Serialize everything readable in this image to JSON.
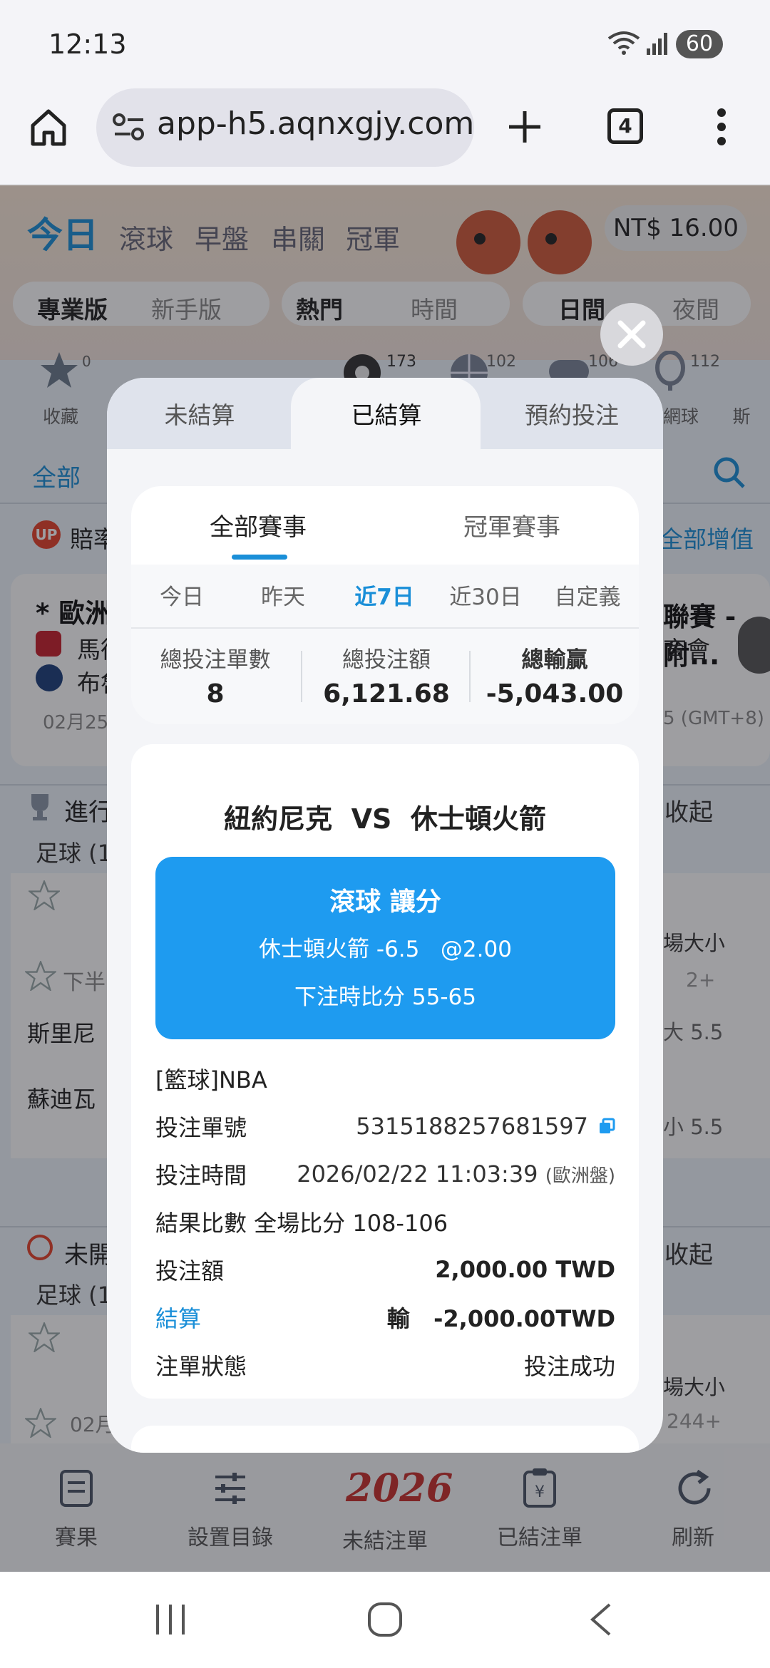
{
  "status": {
    "time": "12:13",
    "battery": "60"
  },
  "browser": {
    "url": "app-h5.aqnxgjy.com",
    "tabs_count": "4"
  },
  "background": {
    "tabs": [
      "今日",
      "滾球",
      "早盤",
      "串關",
      "冠軍"
    ],
    "balance": "NT$ 16.00",
    "modes": [
      "專業版",
      "新手版",
      "熱門",
      "時間",
      "日間",
      "夜間"
    ],
    "categories": [
      {
        "label": "收藏",
        "count": "0"
      },
      {
        "label": "",
        "count": ""
      },
      {
        "label": "",
        "count": ""
      },
      {
        "label": "",
        "count": "173"
      },
      {
        "label": "",
        "count": "102"
      },
      {
        "label": "",
        "count": "106"
      },
      {
        "label": "網球",
        "count": "112"
      },
      {
        "label": "斯",
        "count": ""
      }
    ],
    "filter_all": "全部",
    "odds_boost": "賠率",
    "all_boost": "全部增值",
    "match_title_left": "* 歐洲",
    "team_left_1": "馬德",
    "team_left_2": "布魯",
    "match_date_left": "02月25",
    "match_title_right": "聯賽 - 附...",
    "team_right": "育會",
    "tz_right": "5 (GMT+8)",
    "live_label": "進行",
    "collapse": "收起",
    "football_1": "足球 (1",
    "half": "下半",
    "team_a": "斯里尼",
    "team_b": "蘇迪瓦",
    "total_label": "場大小",
    "more": "2+",
    "over": "大 5.5",
    "under": "小 5.5",
    "upcoming_label": "未開",
    "collapse2": "收起",
    "football_2": "足球 (1",
    "date_2": "02月",
    "total_label_2": "場大小",
    "more_2": "244+"
  },
  "bottom_nav": [
    "賽果",
    "設置目錄",
    "未結注單",
    "已結注單",
    "刷新"
  ],
  "bottom_logo": "2026",
  "modal": {
    "tabs": [
      "未結算",
      "已結算",
      "預約投注"
    ],
    "active_tab": 1,
    "subtabs": [
      "全部賽事",
      "冠軍賽事"
    ],
    "date_filters": [
      "今日",
      "昨天",
      "近7日",
      "近30日",
      "自定義"
    ],
    "active_date": 2,
    "summary": {
      "count_label": "總投注單數",
      "count": "8",
      "amount_label": "總投注額",
      "amount": "6,121.68",
      "winloss_label": "總輸贏",
      "winloss": "-5,043.00"
    },
    "bet": {
      "match": "紐約尼克  VS  休士頓火箭",
      "market": "滾球 讓分",
      "selection": "休士頓火箭 -6.5   @2.00",
      "score_at_bet": "下注時比分 55-65",
      "league": "[籃球]NBA",
      "id_label": "投注單號",
      "id": "5315188257681597",
      "time_label": "投注時間",
      "time": "2026/02/22 11:03:39",
      "time_note": "(歐洲盤)",
      "result": "結果比數 全場比分 108-106",
      "stake_label": "投注額",
      "stake": "2,000.00 TWD",
      "settle_label": "結算",
      "settle_outcome": "輸",
      "settle_amount": "-2,000.00TWD",
      "status_label": "注單狀態",
      "status": "投注成功"
    }
  },
  "colors": {
    "accent": "#1e9bf0",
    "active_blue": "#1a8fd8",
    "text": "#222222"
  }
}
